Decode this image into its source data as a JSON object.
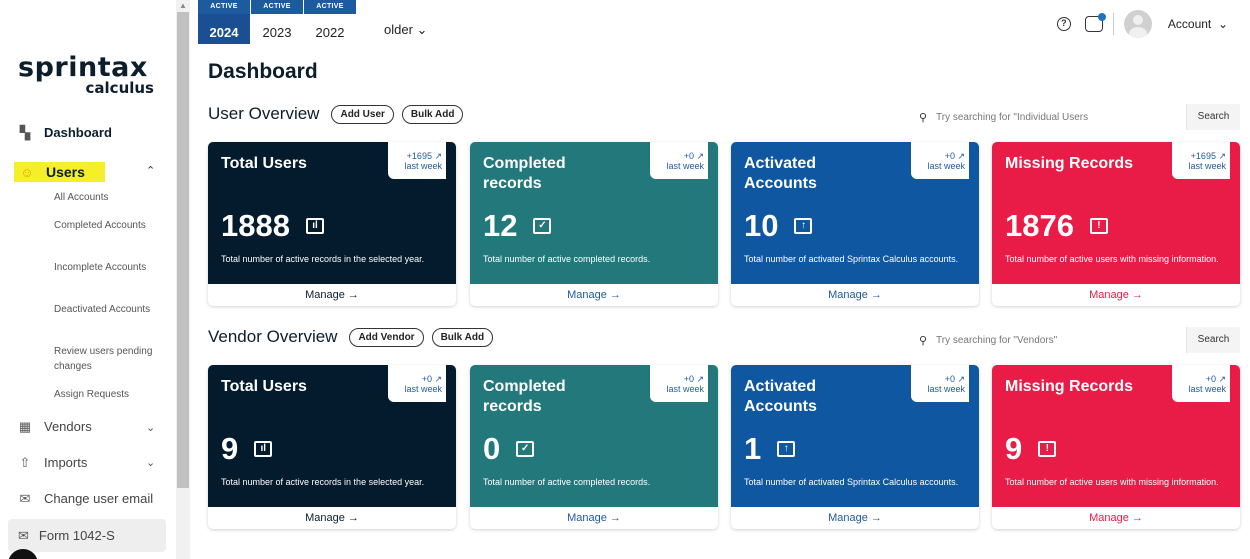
{
  "sidebar": {
    "logo_main": "sprintax",
    "logo_sub": "calculus",
    "dashboard": "Dashboard",
    "users": "Users",
    "sub_items": [
      "All Accounts",
      "Completed Accounts",
      "Incomplete Accounts",
      "Deactivated Accounts",
      "Review users pending changes",
      "Assign Requests"
    ],
    "vendors": "Vendors",
    "imports": "Imports",
    "change_email": "Change user email",
    "form": "Form 1042-S"
  },
  "topbar": {
    "years": [
      {
        "badge": "ACTIVE",
        "year": "2024"
      },
      {
        "badge": "ACTIVE",
        "year": "2023"
      },
      {
        "badge": "ACTIVE",
        "year": "2022"
      }
    ],
    "older": "older",
    "account": "Account"
  },
  "main": {
    "title": "Dashboard",
    "user_overview": {
      "title": "User Overview",
      "add": "Add User",
      "bulk": "Bulk Add",
      "search_placeholder": "Try searching for \"Individual Users",
      "search_btn": "Search",
      "cards": [
        {
          "title": "Total Users",
          "delta": "+1695 ↗",
          "delta_sub": "last week",
          "value": "1888",
          "desc": "Total number of active records in the selected year.",
          "manage": "Manage"
        },
        {
          "title": "Completed records",
          "delta": "+0 ↗",
          "delta_sub": "last week",
          "value": "12",
          "desc": "Total number of active completed records.",
          "manage": "Manage"
        },
        {
          "title": "Activated Accounts",
          "delta": "+0 ↗",
          "delta_sub": "last week",
          "value": "10",
          "desc": "Total number of activated Sprintax Calculus accounts.",
          "manage": "Manage"
        },
        {
          "title": "Missing Records",
          "delta": "+1695 ↗",
          "delta_sub": "last week",
          "value": "1876",
          "desc": "Total number of active users with missing information.",
          "manage": "Manage"
        }
      ]
    },
    "vendor_overview": {
      "title": "Vendor Overview",
      "add": "Add Vendor",
      "bulk": "Bulk Add",
      "search_placeholder": "Try searching for \"Vendors\"",
      "search_btn": "Search",
      "cards": [
        {
          "title": "Total Users",
          "delta": "+0 ↗",
          "delta_sub": "last week",
          "value": "9",
          "desc": "Total number of active records in the selected year.",
          "manage": "Manage"
        },
        {
          "title": "Completed records",
          "delta": "+0 ↗",
          "delta_sub": "last week",
          "value": "0",
          "desc": "Total number of active completed records.",
          "manage": "Manage"
        },
        {
          "title": "Activated Accounts",
          "delta": "+0 ↗",
          "delta_sub": "last week",
          "value": "1",
          "desc": "Total number of activated Sprintax Calculus accounts.",
          "manage": "Manage"
        },
        {
          "title": "Missing Records",
          "delta": "+0 ↗",
          "delta_sub": "last week",
          "value": "9",
          "desc": "Total number of active users with missing information.",
          "manage": "Manage"
        }
      ]
    }
  },
  "colors": {
    "dark": "#031b2c",
    "teal": "#23787c",
    "blue": "#0f57a0",
    "red": "#e81c46",
    "highlight": "#f5ef2a"
  }
}
